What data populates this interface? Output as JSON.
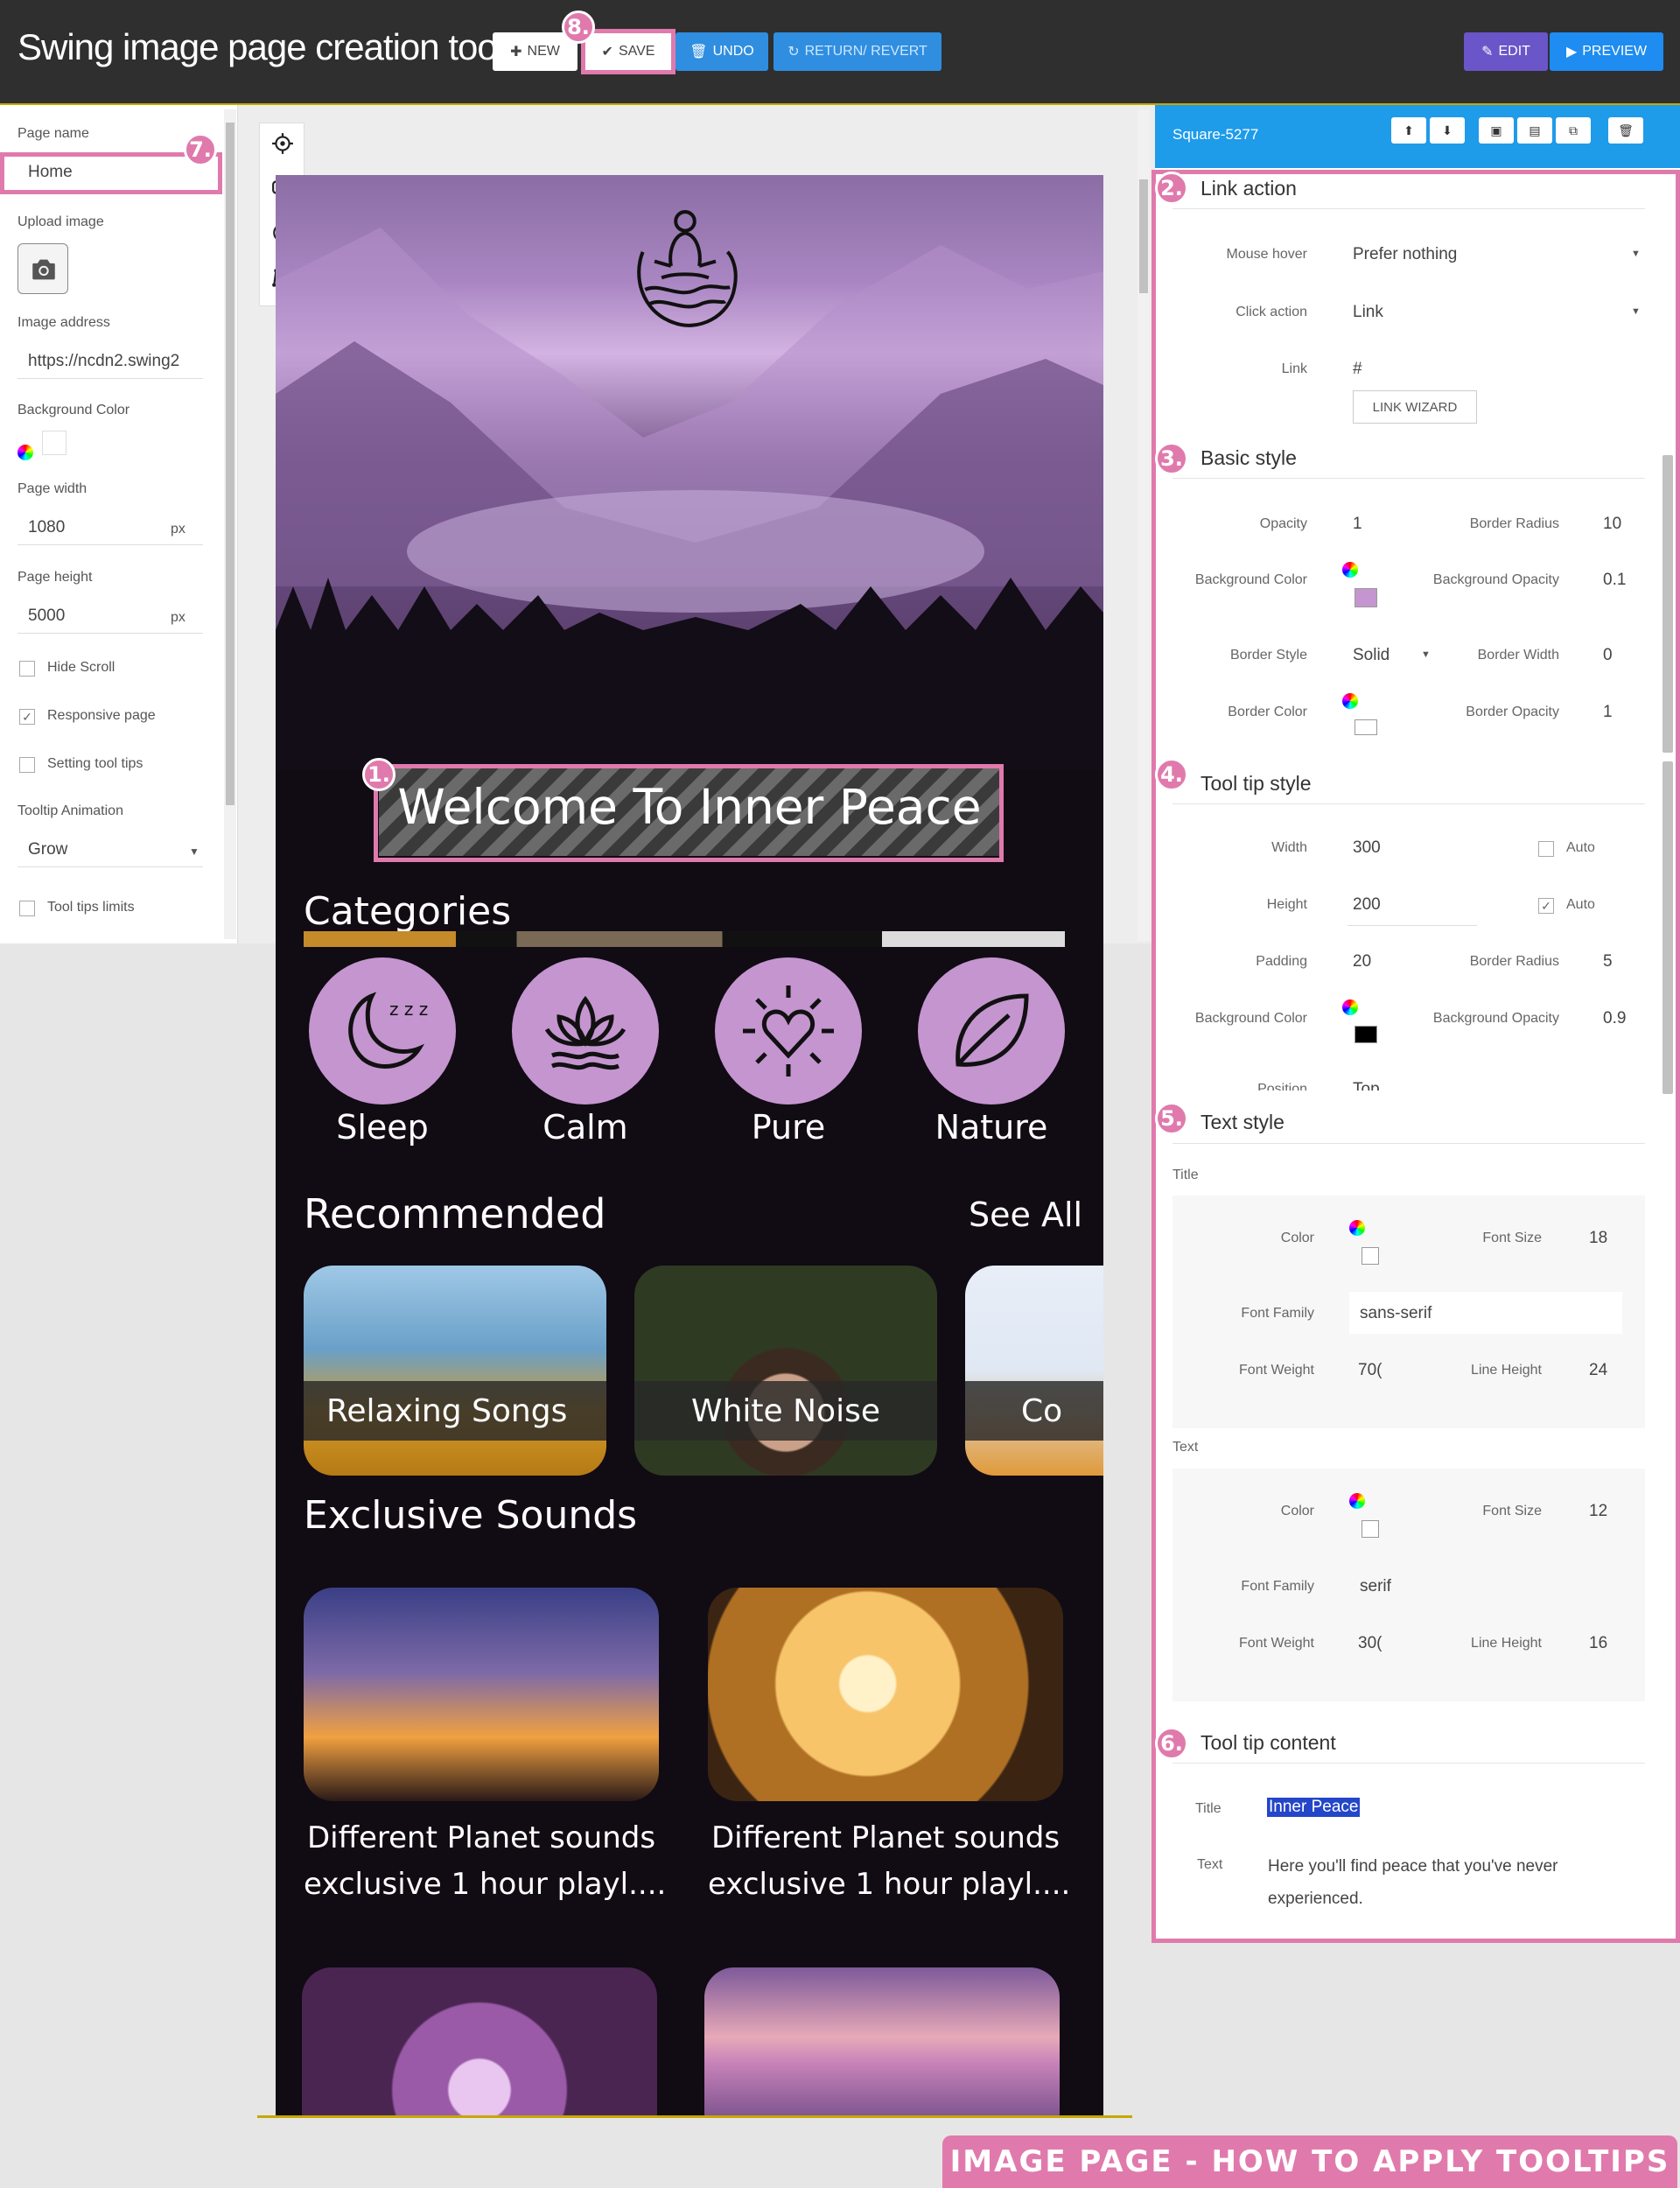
{
  "header": {
    "title": "Swing image page creation tool",
    "new_label": "NEW",
    "save_label": "SAVE",
    "undo_label": "UNDO",
    "revert_label": "RETURN/ REVERT",
    "edit_label": "EDIT",
    "preview_label": "PREVIEW"
  },
  "badges": {
    "b1": "1.",
    "b2": "2.",
    "b3": "3.",
    "b4": "4.",
    "b5": "5.",
    "b6": "6.",
    "b7": "7.",
    "b8": "8."
  },
  "left_panel": {
    "page_name_label": "Page name",
    "page_name_value": "Home",
    "upload_label": "Upload image",
    "image_address_label": "Image address",
    "image_address_value": "https://ncdn2.swing2",
    "bg_color_label": "Background Color",
    "page_width_label": "Page width",
    "page_width_value": "1080",
    "page_height_label": "Page height",
    "page_height_value": "5000",
    "unit": "px",
    "hide_scroll_label": "Hide Scroll",
    "responsive_label": "Responsive page",
    "tooltips_label": "Setting tool tips",
    "tooltip_anim_label": "Tooltip Animation",
    "tooltip_anim_value": "Grow",
    "tooltip_limits_label": "Tool tips limits"
  },
  "page": {
    "welcome": "Welcome To Inner Peace",
    "categories_title": "Categories",
    "categories": [
      "Sleep",
      "Calm",
      "Pure",
      "Nature"
    ],
    "recommended_title": "Recommended",
    "see_all": "See All",
    "recommended": [
      "Relaxing Songs",
      "White Noise",
      "Co"
    ],
    "exclusive_title": "Exclusive Sounds",
    "exclusive_line1": "Different Planet sounds",
    "exclusive_line2": "exclusive 1 hour playl...."
  },
  "right_panel": {
    "object_name": "Square-5277",
    "link_action": {
      "title": "Link action",
      "mouse_hover_label": "Mouse hover",
      "mouse_hover_value": "Prefer nothing",
      "click_action_label": "Click action",
      "click_action_value": "Link",
      "link_label": "Link",
      "link_value": "#",
      "wizard_label": "LINK WIZARD"
    },
    "basic_style": {
      "title": "Basic style",
      "opacity_label": "Opacity",
      "opacity_value": "1",
      "border_radius_label": "Border Radius",
      "border_radius_value": "10",
      "bg_color_label": "Background Color",
      "bg_opacity_label": "Background Opacity",
      "bg_opacity_value": "0.1",
      "border_style_label": "Border Style",
      "border_style_value": "Solid",
      "border_width_label": "Border Width",
      "border_width_value": "0",
      "border_color_label": "Border Color",
      "border_opacity_label": "Border Opacity",
      "border_opacity_value": "1",
      "bg_color": "#c495cf"
    },
    "tooltip_style": {
      "title": "Tool tip style",
      "width_label": "Width",
      "width_value": "300",
      "height_label": "Height",
      "height_value": "200",
      "auto_label": "Auto",
      "padding_label": "Padding",
      "padding_value": "20",
      "border_radius_label": "Border Radius",
      "border_radius_value": "5",
      "bg_color_label": "Background Color",
      "bg_opacity_label": "Background Opacity",
      "bg_opacity_value": "0.9",
      "position_label": "Position",
      "position_value": "Top",
      "bg_color": "#000000"
    },
    "text_style": {
      "title": "Text style",
      "title_group": "Title",
      "text_group": "Text",
      "color_label": "Color",
      "font_size_label": "Font Size",
      "font_family_label": "Font Family",
      "font_weight_label": "Font Weight",
      "line_height_label": "Line Height",
      "title_font_size": "18",
      "title_font_family": "sans-serif",
      "title_font_weight": "70(",
      "title_line_height": "24",
      "text_font_size": "12",
      "text_font_family": "serif",
      "text_font_weight": "30(",
      "text_line_height": "16"
    },
    "tooltip_content": {
      "title": "Tool tip content",
      "title_label": "Title",
      "title_value": "Inner Peace",
      "text_label": "Text",
      "text_line1": "Here you'll find peace that you've never",
      "text_line2": "experienced."
    }
  },
  "banner": "Image page - how to apply tooltips",
  "colors": {
    "accent_pink": "#e07aac",
    "blue": "#2f8ee0",
    "purple": "#6a55c9",
    "header_bg": "#2f2f2f"
  }
}
